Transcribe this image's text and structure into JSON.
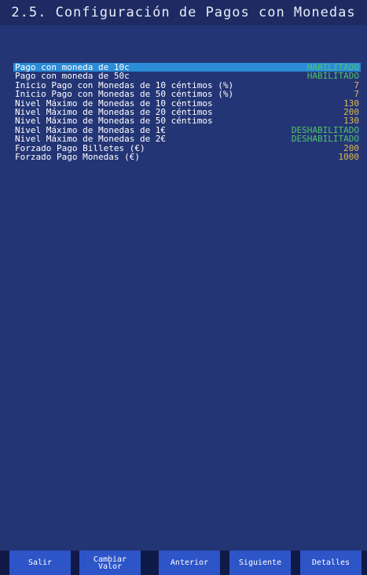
{
  "title": "2.5. Configuración de Pagos con Monedas",
  "settings": [
    {
      "label": "Pago con moneda de 10c",
      "value": "HABILITADO",
      "status": true,
      "selected": true
    },
    {
      "label": "Pago con moneda de 50c",
      "value": "HABILITADO",
      "status": true,
      "selected": false
    },
    {
      "label": "Inicio Pago con Monedas de 10 céntimos (%)",
      "value": "7",
      "status": false,
      "selected": false
    },
    {
      "label": "Inicio Pago con Monedas de 50 céntimos (%)",
      "value": "7",
      "status": false,
      "selected": false
    },
    {
      "label": "Nivel Máximo de Monedas de 10 céntimos",
      "value": "130",
      "status": false,
      "selected": false
    },
    {
      "label": "Nivel Máximo de Monedas de 20 céntimos",
      "value": "200",
      "status": false,
      "selected": false
    },
    {
      "label": "Nivel Máximo de Monedas de 50 céntimos",
      "value": "130",
      "status": false,
      "selected": false
    },
    {
      "label": "Nivel Máximo de Monedas de 1€",
      "value": "DESHABILITADO",
      "status": true,
      "selected": false
    },
    {
      "label": "Nivel Máximo de Monedas de 2€",
      "value": "DESHABILITADO",
      "status": true,
      "selected": false
    },
    {
      "label": "Forzado Pago Billetes (€)",
      "value": "200",
      "status": false,
      "selected": false
    },
    {
      "label": "Forzado Pago Monedas (€)",
      "value": "1000",
      "status": false,
      "selected": false
    }
  ],
  "buttons": {
    "exit": "Salir",
    "change_value": "Cambiar\nValor",
    "previous": "Anterior",
    "next": "Siguiente",
    "details": "Detalles"
  },
  "colors": {
    "background": "#243575",
    "title_bar": "#1d2b62",
    "selected_row": "#2b8cd8",
    "status_value": "#4fc46a",
    "numeric_value": "#e0b84a",
    "button": "#2d55c8"
  }
}
